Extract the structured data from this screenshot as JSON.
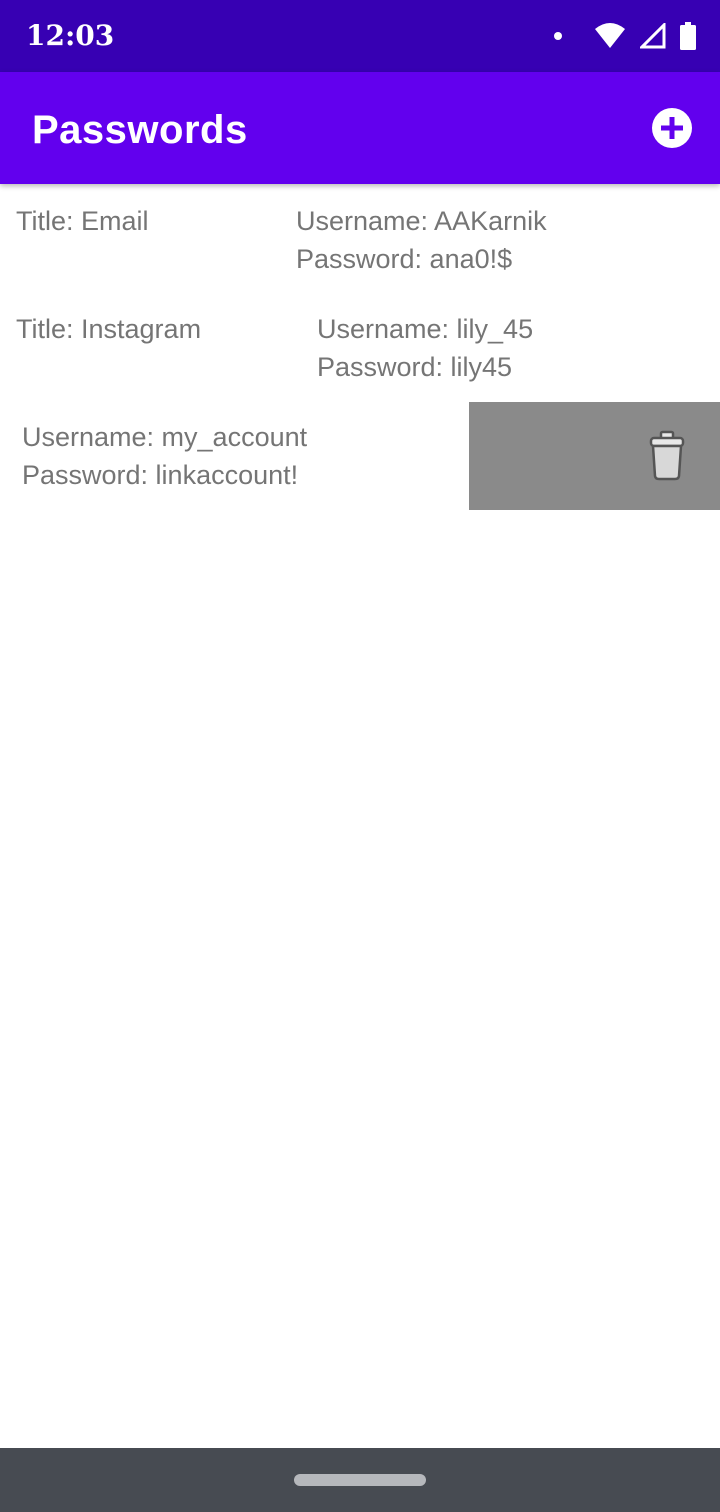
{
  "status_bar": {
    "time": "12:03",
    "icons": [
      "notification-dot-icon",
      "wifi-icon",
      "cellular-signal-icon",
      "battery-icon"
    ]
  },
  "app_bar": {
    "title": "Passwords",
    "add_icon": "add-circle-icon"
  },
  "entries": [
    {
      "title": "Title: Email",
      "username": "Username: AAKarnik",
      "password": "Password: ana0!$"
    },
    {
      "title": "Title: Instagram",
      "username": "Username: lily_45",
      "password": "Password: lily45"
    },
    {
      "username": "Username: my_account",
      "password": "Password: linkaccount!",
      "action_icon": "trash-icon"
    }
  ],
  "colors": {
    "status_bar": "#3700b3",
    "app_bar": "#6200ee",
    "text": "#757575",
    "delete_background": "#8a8a8a",
    "nav_bar": "#474b52"
  }
}
